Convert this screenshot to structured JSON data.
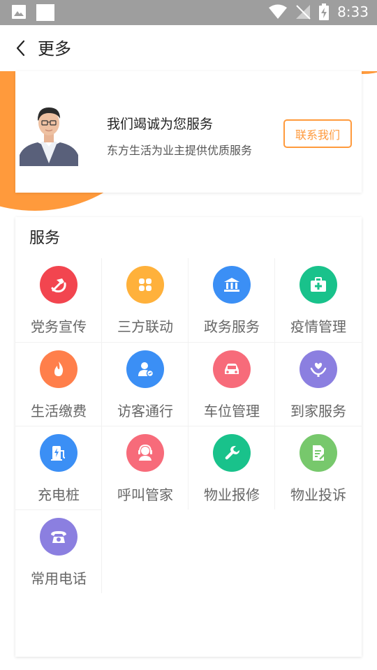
{
  "status_bar": {
    "time": "8:33"
  },
  "navbar": {
    "title": "更多"
  },
  "hero": {
    "title": "我们竭诚为您服务",
    "subtitle": "东方生活为业主提供优质服务",
    "contact_label": "联系我们"
  },
  "services": {
    "title": "服务",
    "items": [
      {
        "label": "党务宣传",
        "icon": "party-emblem-icon",
        "color": "#f2454f"
      },
      {
        "label": "三方联动",
        "icon": "clover-icon",
        "color": "#ffb13b"
      },
      {
        "label": "政务服务",
        "icon": "government-building-icon",
        "color": "#3b8ff5"
      },
      {
        "label": "疫情管理",
        "icon": "medical-kit-icon",
        "color": "#19c28b"
      },
      {
        "label": "生活缴费",
        "icon": "flame-icon",
        "color": "#ff7f4b"
      },
      {
        "label": "访客通行",
        "icon": "visitor-icon",
        "color": "#3b8ff5"
      },
      {
        "label": "车位管理",
        "icon": "car-icon",
        "color": "#f76b7a"
      },
      {
        "label": "到家服务",
        "icon": "heart-hand-icon",
        "color": "#8b7fe0"
      },
      {
        "label": "充电桩",
        "icon": "charging-pile-icon",
        "color": "#3b8ff5"
      },
      {
        "label": "呼叫管家",
        "icon": "headset-icon",
        "color": "#f76b7a"
      },
      {
        "label": "物业报修",
        "icon": "wrench-icon",
        "color": "#19c28b"
      },
      {
        "label": "物业投诉",
        "icon": "complaint-doc-icon",
        "color": "#77c86c"
      },
      {
        "label": "常用电话",
        "icon": "telephone-icon",
        "color": "#8b7fe0"
      }
    ]
  }
}
